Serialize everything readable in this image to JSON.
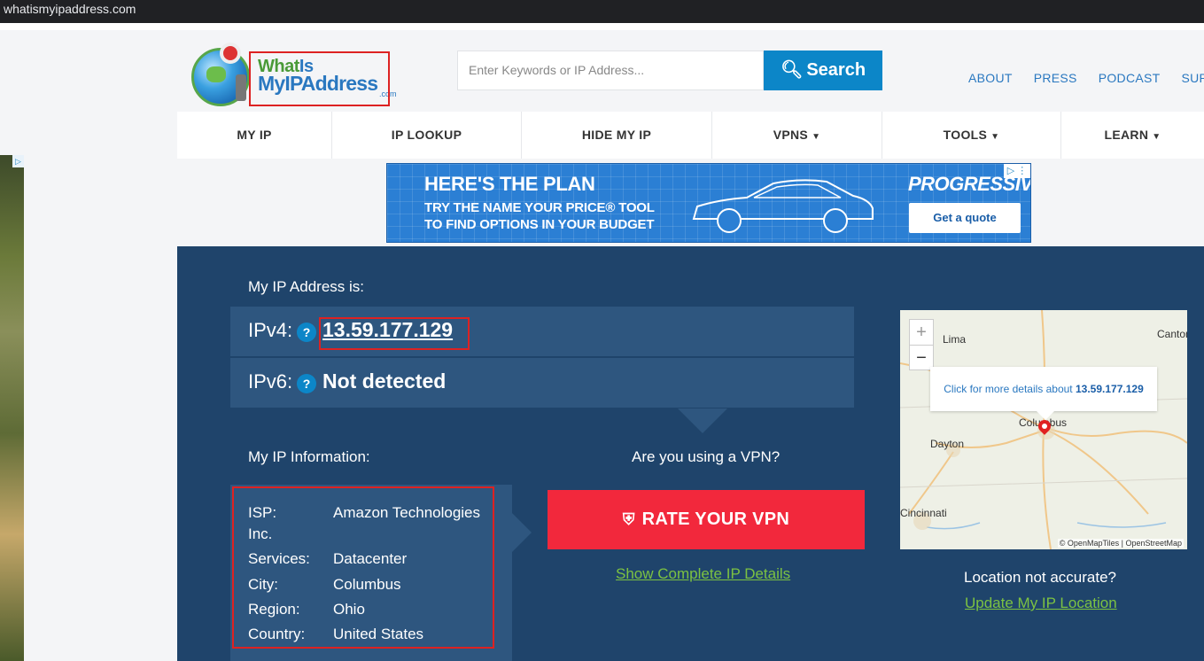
{
  "browser": {
    "url": "whatismyipaddress.com"
  },
  "header": {
    "logo": {
      "line1_a": "What",
      "line1_b": "Is",
      "line2": "MyIPAddress",
      "suffix": ".com"
    },
    "search": {
      "placeholder": "Enter Keywords or IP Address...",
      "button_label": "Search"
    },
    "top_links": [
      "ABOUT",
      "PRESS",
      "PODCAST",
      "SUPPO"
    ]
  },
  "nav": {
    "items": [
      {
        "label": "MY IP",
        "dropdown": false
      },
      {
        "label": "IP LOOKUP",
        "dropdown": false
      },
      {
        "label": "HIDE MY IP",
        "dropdown": false
      },
      {
        "label": "VPNS",
        "dropdown": true
      },
      {
        "label": "TOOLS",
        "dropdown": true
      },
      {
        "label": "LEARN",
        "dropdown": true
      }
    ],
    "caret": "▼"
  },
  "ad_banner": {
    "headline": "HERE'S THE PLAN",
    "line1": "TRY THE NAME YOUR PRICE® TOOL",
    "line2": "TO FIND OPTIONS IN YOUR BUDGET",
    "brand": "PROGRESSIVE",
    "cta": "Get a quote"
  },
  "ip": {
    "label": "My IP Address is:",
    "ipv4_label": "IPv4:",
    "ipv4_value": "13.59.177.129",
    "ipv6_label": "IPv6:",
    "ipv6_value": "Not detected",
    "help": "?"
  },
  "info": {
    "label": "My IP Information:",
    "rows": [
      {
        "key": "ISP:",
        "value": "Amazon Technologies",
        "cont": "Inc."
      },
      {
        "key": "Services:",
        "value": "Datacenter"
      },
      {
        "key": "City:",
        "value": "Columbus"
      },
      {
        "key": "Region:",
        "value": "Ohio"
      },
      {
        "key": "Country:",
        "value": "United States"
      }
    ]
  },
  "vpn": {
    "question": "Are you using a VPN?",
    "button_label": "RATE YOUR VPN",
    "details_link": "Show Complete IP Details"
  },
  "map": {
    "zoom_in": "+",
    "zoom_out": "−",
    "popup_text": "Click for more details about",
    "popup_ip": "13.59.177.129",
    "cities": [
      "Lima",
      "Canton",
      "Columbus",
      "Dayton",
      "Cincinnati"
    ],
    "attribution": "© OpenMapTiles | OpenStreetMap",
    "location_question": "Location not accurate?",
    "update_link": "Update My IP Location"
  },
  "colors": {
    "main_bg": "#1f446b",
    "panel_bg": "#2e567f",
    "accent_blue": "#0c86c8",
    "rate_red": "#f2283c",
    "link_green": "#7cc242",
    "highlight_red": "#d22222"
  }
}
